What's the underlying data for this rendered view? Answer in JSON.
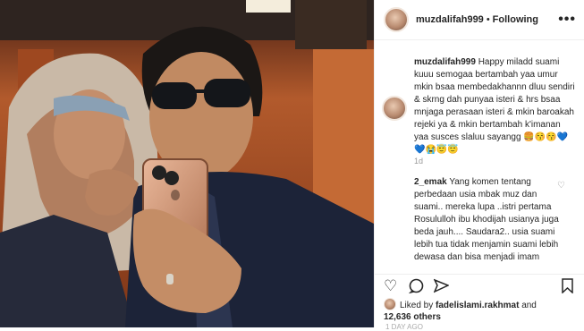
{
  "post": {
    "username": "muzdalifah999",
    "separator": "•",
    "follow_label": "Following",
    "more_icon": "•••"
  },
  "caption": {
    "username": "muzdalifah999",
    "text": "Happy miladd suami kuuu semogaa bertambah yaa umur mkin bsaa membedakhannn dluu sendiri & skrng dah punyaa isteri & hrs bsaa mnjaga perasaan isteri & mkin baroakah rejeki ya & mkin bertambah k'imanan yaa susces slaluu sayangg 🍔😚😚💙💙😭😇😇",
    "age": "1d"
  },
  "comment": {
    "username": "2_emak",
    "text": "Yang komen tentang perbedaan usia mbak muz dan suami.. mereka lupa ..istri pertama Rosululloh ibu khodijah usianya juga beda jauh.... Saudara2.. usia suami lebih tua tidak menjamin suami lebih dewasa dan bisa menjadi imam"
  },
  "likes": {
    "prefix": "Liked by",
    "user": "fadelislami.rakhmat",
    "and": "and",
    "count": "12,636 others"
  },
  "timestamp": "1 DAY AGO",
  "colors": {
    "accent": "#262626",
    "meta": "#999999",
    "border": "#efefef"
  }
}
